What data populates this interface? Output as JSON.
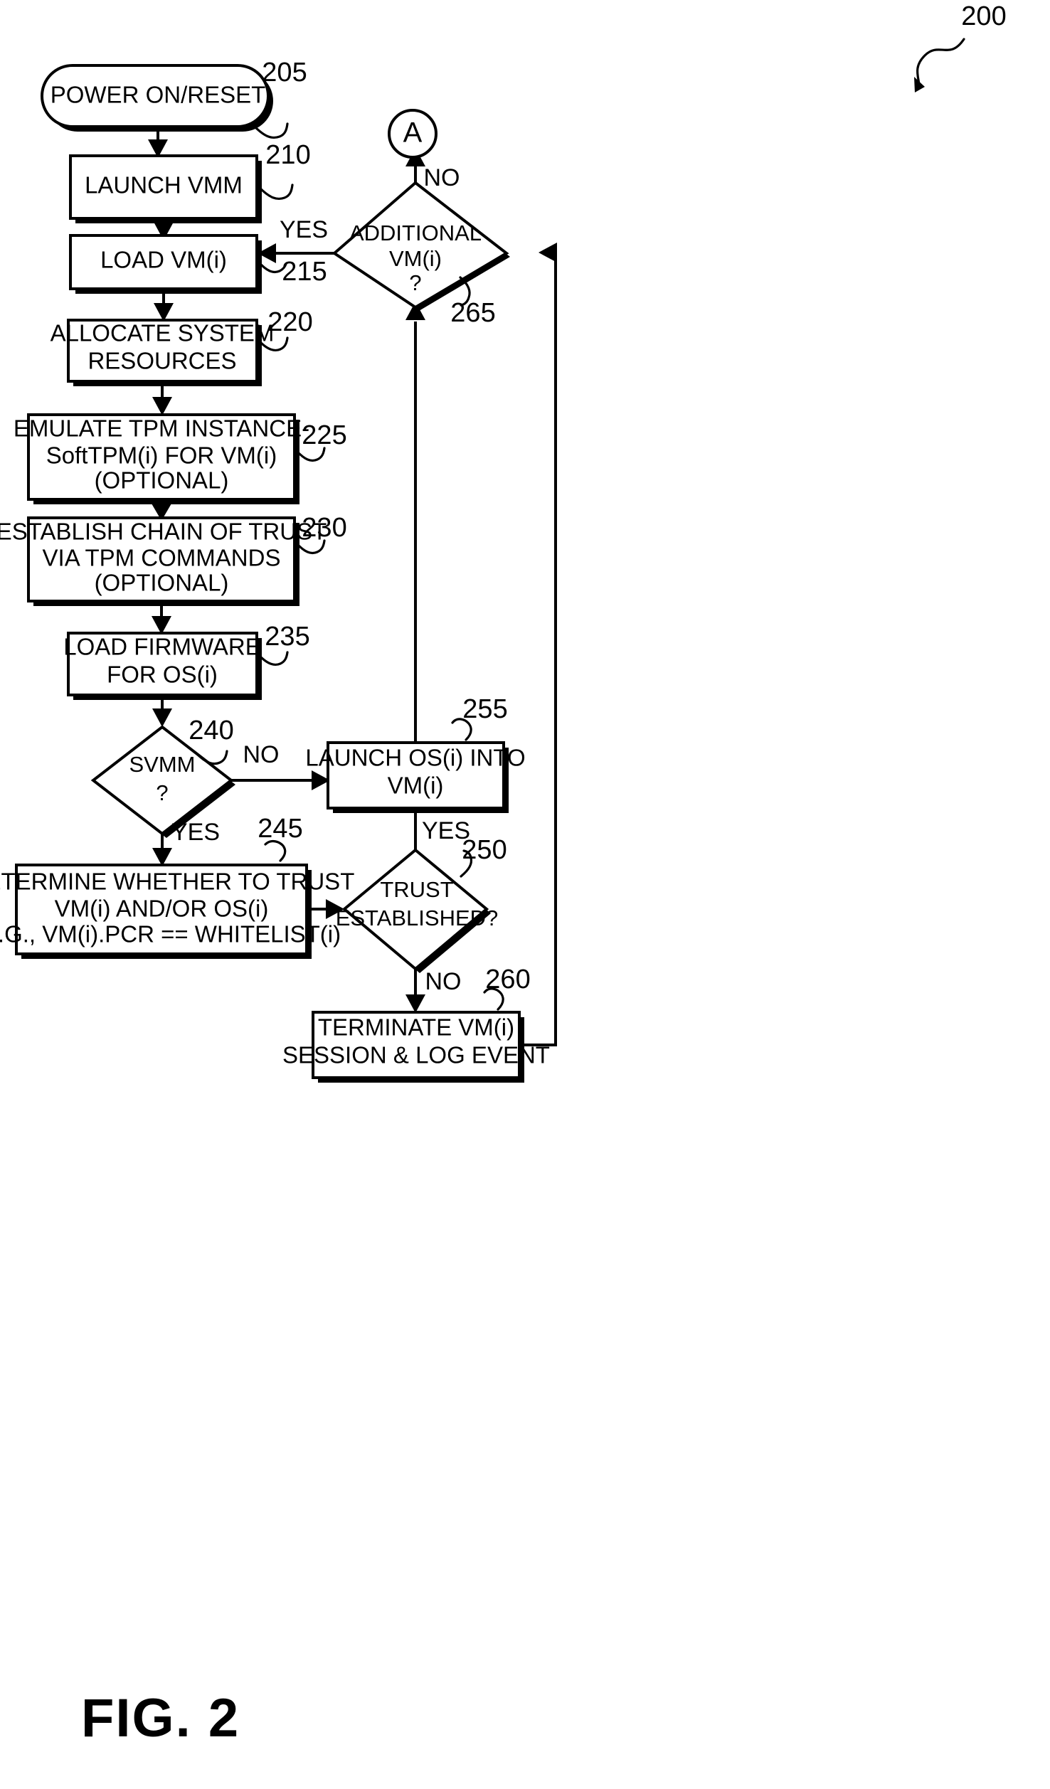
{
  "figure": {
    "label": "FIG. 2",
    "top_ref": "200"
  },
  "nodes": {
    "power_on": {
      "ref": "205",
      "text": "POWER ON/RESET",
      "shape": "terminator"
    },
    "launch_vmm": {
      "ref": "210",
      "text": "LAUNCH VMM",
      "shape": "process"
    },
    "load_vm": {
      "ref": "215",
      "text": "LOAD VM(i)",
      "shape": "process"
    },
    "allocate": {
      "ref": "220",
      "line1": "ALLOCATE SYSTEM",
      "line2": "RESOURCES",
      "shape": "process"
    },
    "emulate_tpm": {
      "ref": "225",
      "line1": "EMULATE TPM INSTANCE-",
      "line2": "SoftTPM(i) FOR VM(i)",
      "line3": "(OPTIONAL)",
      "shape": "process"
    },
    "establish_chain": {
      "ref": "230",
      "line1": "ESTABLISH CHAIN OF TRUST",
      "line2": "VIA TPM COMMANDS",
      "line3": "(OPTIONAL)",
      "shape": "process"
    },
    "load_firmware": {
      "ref": "235",
      "line1": "LOAD FIRMWARE",
      "line2": "FOR OS(i)",
      "shape": "process"
    },
    "svmm": {
      "ref": "240",
      "line1": "SVMM",
      "line2": "?",
      "shape": "decision"
    },
    "determine_trust": {
      "ref": "245",
      "line1": "DETERMINE WHETHER TO TRUST",
      "line2": "VM(i) AND/OR OS(i)",
      "line3": "E.G., VM(i).PCR == WHITELIST(i)",
      "shape": "process"
    },
    "trust_established": {
      "ref": "250",
      "line1": "TRUST",
      "line2": "ESTABLISHED?",
      "shape": "decision"
    },
    "launch_os": {
      "ref": "255",
      "line1": "LAUNCH OS(i) INTO",
      "line2": "VM(i)",
      "shape": "process"
    },
    "terminate": {
      "ref": "260",
      "line1": "TERMINATE VM(i)",
      "line2": "SESSION & LOG EVENT",
      "shape": "process"
    },
    "additional_vm": {
      "ref": "265",
      "line1": "ADDITIONAL",
      "line2": "VM(i)",
      "line3": "?",
      "shape": "decision"
    },
    "connector_a": {
      "text": "A",
      "shape": "connector"
    }
  },
  "edge_labels": {
    "additional_yes": "YES",
    "additional_no": "NO",
    "svmm_no": "NO",
    "svmm_yes": "YES",
    "trust_yes": "YES",
    "trust_no": "NO"
  },
  "colors": {
    "ink": "#000000",
    "paper": "#ffffff"
  }
}
